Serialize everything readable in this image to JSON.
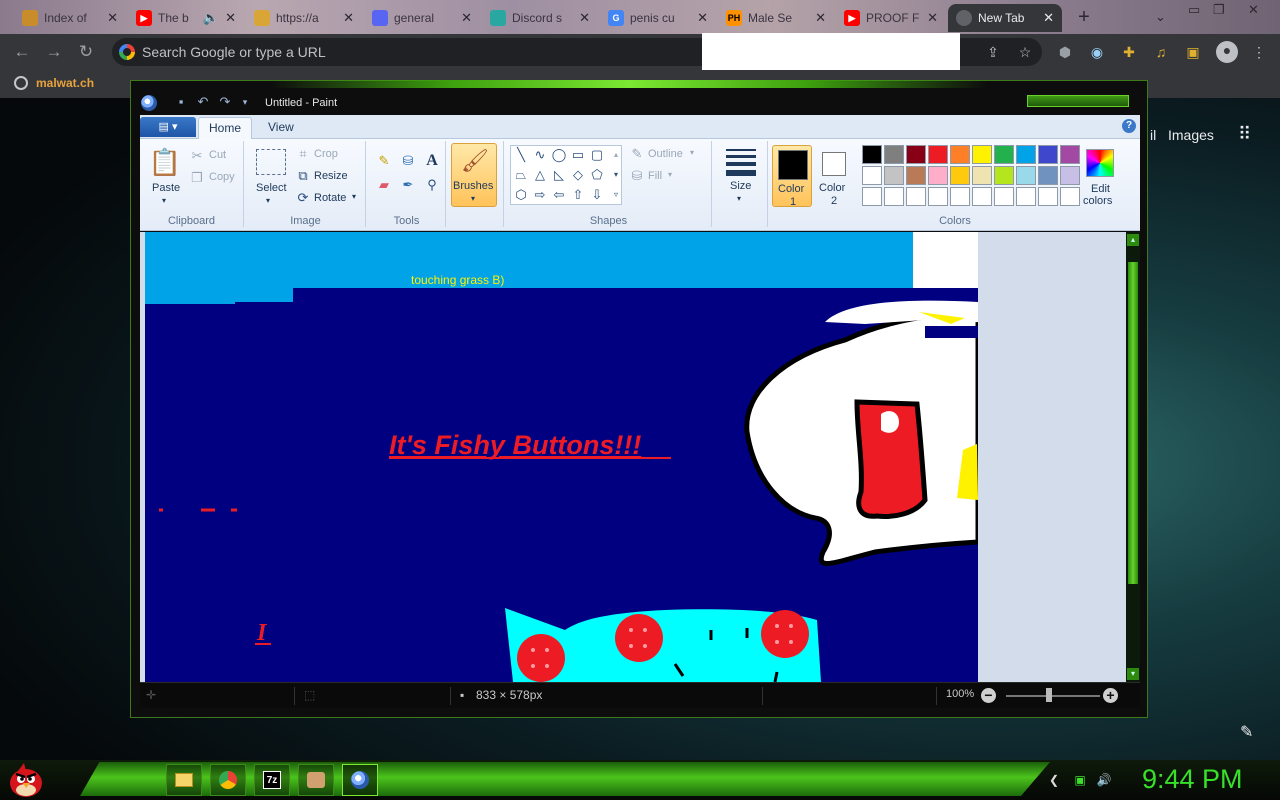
{
  "browser": {
    "tabs": [
      {
        "title": "Index of",
        "favicon_color": "#c98c2a",
        "favicon": "●"
      },
      {
        "title": "The b",
        "favicon_color": "#ff0000",
        "favicon": "▶"
      },
      {
        "title": "https://a",
        "favicon_color": "#d9a536",
        "favicon": "●"
      },
      {
        "title": "general",
        "favicon_color": "#5865f2",
        "favicon": "●"
      },
      {
        "title": "Discord s",
        "favicon_color": "#28a8a0",
        "favicon": "◆"
      },
      {
        "title": "penis cu",
        "favicon_color": "#4285f4",
        "favicon": "G"
      },
      {
        "title": "Male Se",
        "favicon_color": "#ff9000",
        "favicon": "PH"
      },
      {
        "title": "PROOF F",
        "favicon_color": "#ff0000",
        "favicon": "▶"
      },
      {
        "title": "New Tab",
        "favicon_color": "#5f6368",
        "favicon": "●"
      }
    ],
    "new_tab_glyph": "+",
    "omnibox_placeholder": "Search Google or type a URL",
    "bookmark": "malwat.ch",
    "google_links": {
      "gmail_partial": "il",
      "images": "Images"
    }
  },
  "paint": {
    "title": "Untitled - Paint",
    "ribbon_tabs": {
      "home": "Home",
      "view": "View"
    },
    "clipboard": {
      "paste": "Paste",
      "cut": "Cut",
      "copy": "Copy",
      "group": "Clipboard"
    },
    "image": {
      "select": "Select",
      "crop": "Crop",
      "resize": "Resize",
      "rotate": "Rotate",
      "group": "Image"
    },
    "tools": {
      "group": "Tools"
    },
    "brushes": "Brushes",
    "shapes": {
      "outline": "Outline",
      "fill": "Fill",
      "group": "Shapes"
    },
    "size": "Size",
    "colors": {
      "color1": "Color 1",
      "color1_line1": "Color",
      "color1_line2": "1",
      "color2_line1": "Color",
      "color2_line2": "2",
      "edit_line1": "Edit",
      "edit_line2": "colors",
      "group": "Colors",
      "color1_value": "#000000",
      "color2_value": "#ffffff",
      "palette": [
        "#000000",
        "#7f7f7f",
        "#880015",
        "#ed1c24",
        "#ff7f27",
        "#fff200",
        "#22b14c",
        "#00a2e8",
        "#3f48cc",
        "#a349a4",
        "#ffffff",
        "#c3c3c3",
        "#b97a57",
        "#ffaec9",
        "#ffc90e",
        "#efe4b0",
        "#b5e61d",
        "#99d9ea",
        "#7092be",
        "#c8bfe7",
        "#ffffff",
        "#ffffff",
        "#ffffff",
        "#ffffff",
        "#ffffff",
        "#ffffff",
        "#ffffff",
        "#ffffff",
        "#ffffff",
        "#ffffff"
      ]
    },
    "canvas": {
      "grass_text": "touching grass B)",
      "headline": "It's Fishy Buttons!!!",
      "cursor_letter": "I"
    },
    "status": {
      "dimensions": "833 × 578px",
      "zoom": "100%"
    }
  },
  "taskbar": {
    "clock": "9:44 PM"
  }
}
